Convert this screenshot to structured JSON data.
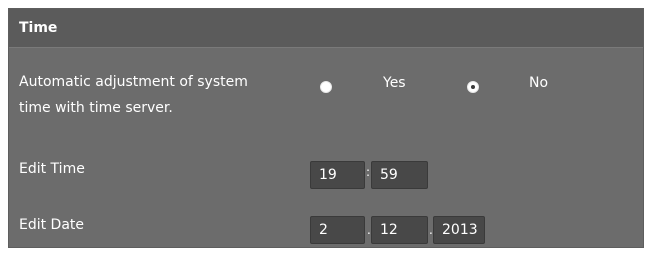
{
  "section": {
    "title": "Time"
  },
  "auto_adjust": {
    "label_line1": "Automatic adjustment of system",
    "label_line2": "time with time server.",
    "options": [
      {
        "label": "Yes",
        "checked": false
      },
      {
        "label": "No",
        "checked": true
      }
    ]
  },
  "edit_time": {
    "label": "Edit Time",
    "hour": "19",
    "separator": ":",
    "minute": "59"
  },
  "edit_date": {
    "label": "Edit Date",
    "day": "2",
    "month": "12",
    "year": "2013",
    "separator": "."
  }
}
